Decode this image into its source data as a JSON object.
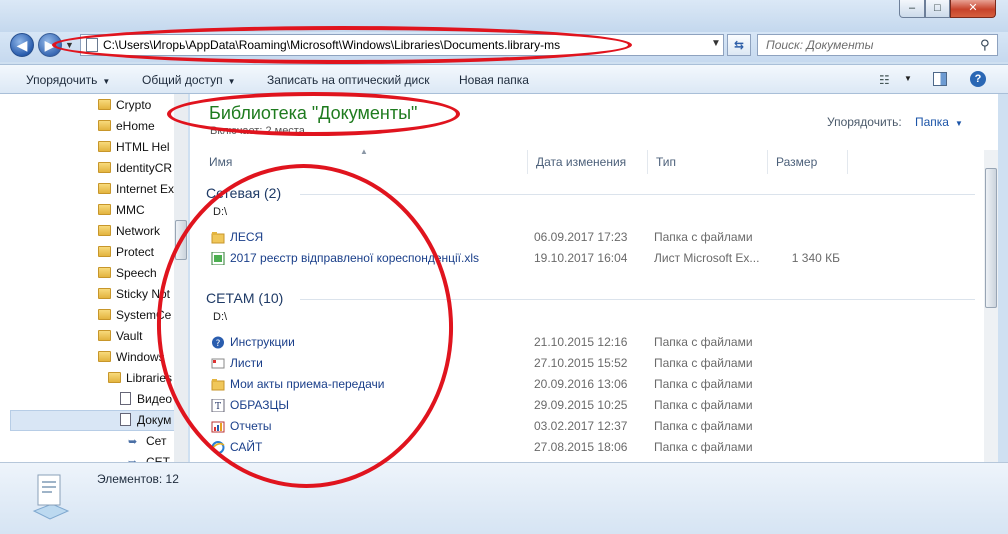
{
  "address": {
    "path": "C:\\Users\\Игорь\\AppData\\Roaming\\Microsoft\\Windows\\Libraries\\Documents.library-ms"
  },
  "search": {
    "placeholder": "Поиск: Документы"
  },
  "toolbar": {
    "organize": "Упорядочить",
    "share": "Общий доступ",
    "burn": "Записать на оптический диск",
    "new_folder": "Новая папка"
  },
  "tree": [
    {
      "label": "Crypto",
      "icon": "folder"
    },
    {
      "label": "eHome",
      "icon": "folder"
    },
    {
      "label": "HTML Hel",
      "icon": "folder"
    },
    {
      "label": "IdentityCR",
      "icon": "folder"
    },
    {
      "label": "Internet Ex",
      "icon": "folder"
    },
    {
      "label": "MMC",
      "icon": "folder"
    },
    {
      "label": "Network",
      "icon": "folder"
    },
    {
      "label": "Protect",
      "icon": "folder"
    },
    {
      "label": "Speech",
      "icon": "folder"
    },
    {
      "label": "Sticky Not",
      "icon": "folder"
    },
    {
      "label": "SystemCe",
      "icon": "folder"
    },
    {
      "label": "Vault",
      "icon": "folder"
    },
    {
      "label": "Windows",
      "icon": "folder"
    },
    {
      "label": "Libraries",
      "icon": "folder"
    },
    {
      "label": "Видео",
      "icon": "doc"
    },
    {
      "label": "Докум",
      "icon": "doc"
    },
    {
      "label": "Сет",
      "icon": "arrow"
    },
    {
      "label": "СЕТ",
      "icon": "arrow"
    }
  ],
  "library": {
    "title": "Библиотека \"Документы\"",
    "includes": "Включает: 2 места",
    "arrange_label": "Упорядочить:",
    "arrange_value": "Папка"
  },
  "columns": {
    "name": "Имя",
    "date": "Дата изменения",
    "type": "Тип",
    "size": "Размер"
  },
  "groups": [
    {
      "header": "Сетевая (2)",
      "path": "D:\\",
      "items": [
        {
          "name": "ЛЕСЯ",
          "date": "06.09.2017 17:23",
          "type": "Папка с файлами",
          "size": "",
          "icon": "folder"
        },
        {
          "name": "2017 реєстр відправленої кореспонденції.xls",
          "date": "19.10.2017 16:04",
          "type": "Лист Microsoft Ex...",
          "size": "1 340 КБ",
          "icon": "excel"
        }
      ]
    },
    {
      "header": "СЕТАМ (10)",
      "path": "D:\\",
      "items": [
        {
          "name": "Инструкции",
          "date": "21.10.2015 12:16",
          "type": "Папка с файлами",
          "size": "",
          "icon": "help"
        },
        {
          "name": "Листи",
          "date": "27.10.2015 15:52",
          "type": "Папка с файлами",
          "size": "",
          "icon": "mail"
        },
        {
          "name": "Мои акты приема-передачи",
          "date": "20.09.2016 13:06",
          "type": "Папка с файлами",
          "size": "",
          "icon": "folder"
        },
        {
          "name": "ОБРАЗЦЫ",
          "date": "29.09.2015 10:25",
          "type": "Папка с файлами",
          "size": "",
          "icon": "text"
        },
        {
          "name": "Отчеты",
          "date": "03.02.2017 12:37",
          "type": "Папка с файлами",
          "size": "",
          "icon": "chart"
        },
        {
          "name": "САЙТ",
          "date": "27.08.2015 18:06",
          "type": "Папка с файлами",
          "size": "",
          "icon": "ie"
        }
      ]
    }
  ],
  "status": {
    "text": "Элементов: 12"
  },
  "window_buttons": {
    "min": "–",
    "max": "□",
    "close": "✕"
  },
  "colors": {
    "annotation": "#e0141e",
    "library_title": "#1e7b1e",
    "link": "#1a3f8a"
  }
}
